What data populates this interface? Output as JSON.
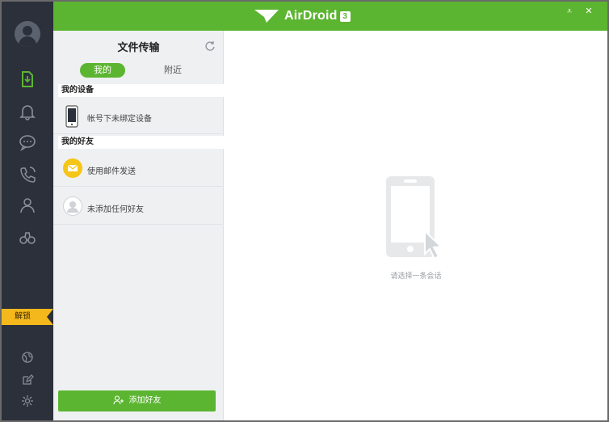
{
  "app": {
    "name": "AirDroid",
    "version": "3",
    "brand_color": "#5cb531",
    "rail_color": "#2b303b"
  },
  "window_controls": {
    "minimize_icon": "minimize-down-icon",
    "close_icon": "close-icon"
  },
  "sidebar": {
    "avatar_icon": "user-avatar-icon",
    "items": [
      {
        "icon": "file-transfer-icon",
        "active": true
      },
      {
        "icon": "bell-icon",
        "active": false
      },
      {
        "icon": "chat-bubble-icon",
        "active": false
      },
      {
        "icon": "phone-call-icon",
        "active": false
      },
      {
        "icon": "contacts-icon",
        "active": false
      },
      {
        "icon": "binoculars-icon",
        "active": false
      }
    ],
    "badge_label": "解锁",
    "bottom_items": [
      {
        "icon": "globe-icon"
      },
      {
        "icon": "edit-icon"
      },
      {
        "icon": "settings-gear-icon"
      }
    ]
  },
  "panel": {
    "title": "文件传输",
    "refresh_icon": "refresh-icon",
    "tabs": {
      "mine": "我的",
      "nearby": "附近"
    },
    "my_devices": {
      "label": "我的设备",
      "empty_text": "帐号下未绑定设备"
    },
    "my_friends": {
      "label": "我的好友",
      "items": [
        {
          "label": "使用邮件发送",
          "icon": "email-icon"
        },
        {
          "label": "未添加任何好友",
          "icon": "friend-avatar-icon"
        }
      ]
    },
    "add_friend_button": "添加好友"
  },
  "main": {
    "empty_icon": "phone-pointer-icon",
    "empty_text": "请选择一条会话"
  }
}
